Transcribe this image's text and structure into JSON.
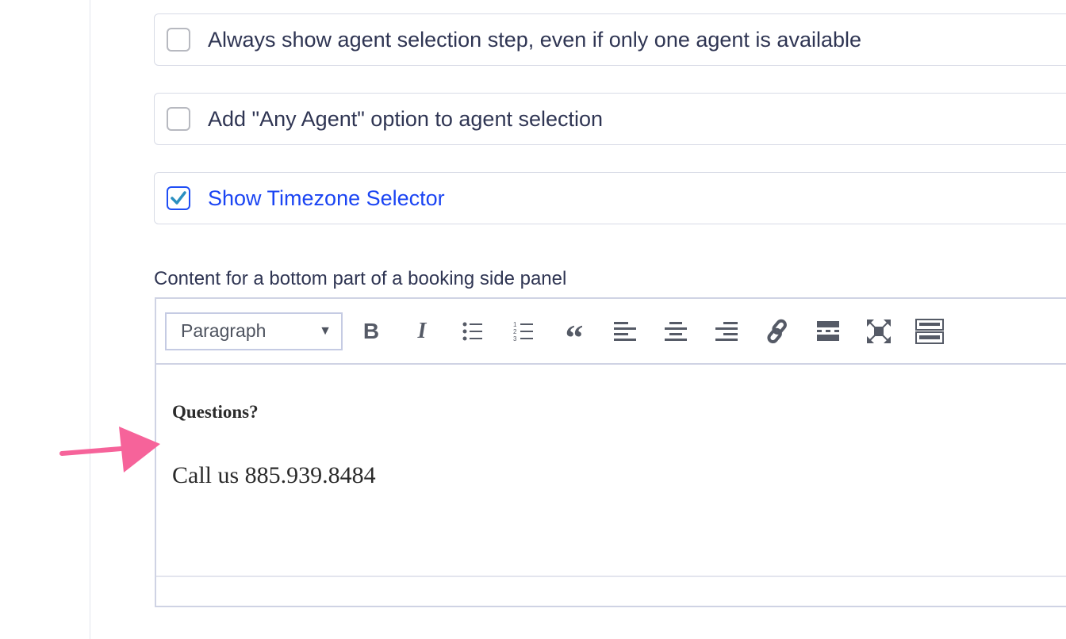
{
  "options": [
    {
      "label": "Always show agent selection step, even if only one agent is available",
      "checked": false
    },
    {
      "label": "Add \"Any Agent\" option to agent selection",
      "checked": false
    },
    {
      "label": "Show Timezone Selector",
      "checked": true
    }
  ],
  "editor": {
    "section_label": "Content for a bottom part of a booking side panel",
    "format_select": "Paragraph",
    "toolbar_icons": [
      "bold-icon",
      "italic-icon",
      "bullet-list-icon",
      "numbered-list-icon",
      "blockquote-icon",
      "align-left-icon",
      "align-center-icon",
      "align-right-icon",
      "link-icon",
      "read-more-icon",
      "fullscreen-icon",
      "toolbar-toggle-icon"
    ],
    "content_heading": "Questions?",
    "content_body": "Call us 885.939.8484"
  },
  "colors": {
    "accent": "#1a44f3",
    "checkmark": "#2a8fc0",
    "arrow": "#f6639a",
    "text": "#2f3553"
  }
}
